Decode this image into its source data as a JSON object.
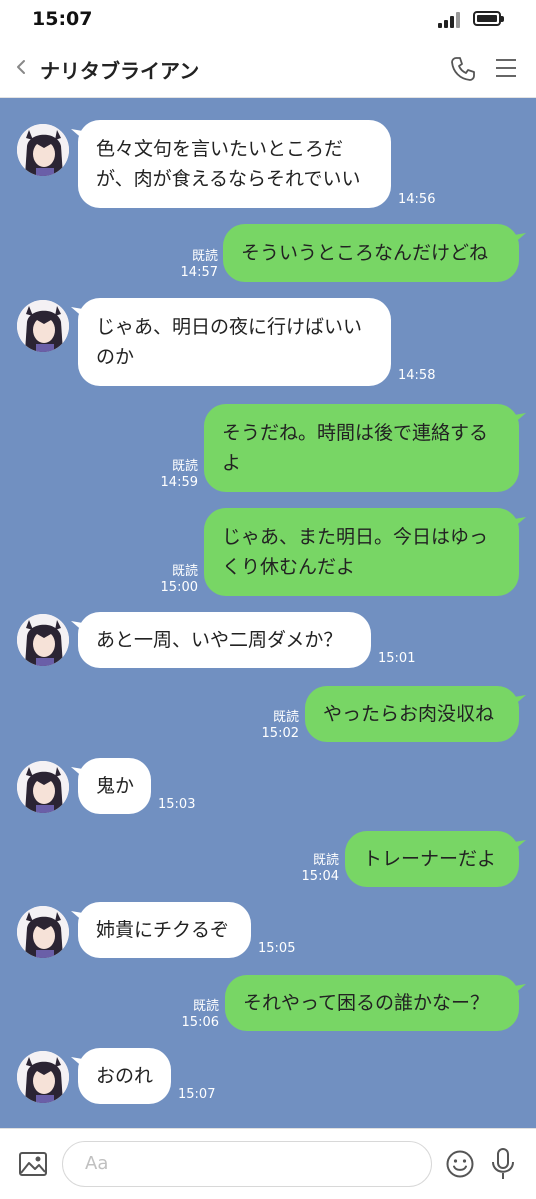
{
  "status": {
    "time": "15:07"
  },
  "header": {
    "back_icon": "chevron-left-icon",
    "title": "ナリタブライアン",
    "phone_icon": "phone-icon",
    "menu_icon": "hamburger-menu-icon"
  },
  "messages": [
    {
      "side": "in",
      "text": "色々文句を言いたいところだ\nが、肉が食えるならそれでいい",
      "time": "14:56"
    },
    {
      "side": "out",
      "text": "そういうところなんだけどね",
      "time": "14:57",
      "read": "既読"
    },
    {
      "side": "in",
      "text": "じゃあ、明日の夜に行けばいい\nのか",
      "time": "14:58"
    },
    {
      "side": "out",
      "text": "そうだね。時間は後で連絡する\nよ",
      "time": "14:59",
      "read": "既読"
    },
    {
      "side": "out",
      "text": "じゃあ、また明日。今日はゆっ\nくり休むんだよ",
      "time": "15:00",
      "read": "既読"
    },
    {
      "side": "in",
      "text": "あと一周、いや二周ダメか？",
      "time": "15:01"
    },
    {
      "side": "out",
      "text": "やったらお肉没収ね",
      "time": "15:02",
      "read": "既読"
    },
    {
      "side": "in",
      "text": "鬼か",
      "time": "15:03"
    },
    {
      "side": "out",
      "text": "トレーナーだよ",
      "time": "15:04",
      "read": "既読"
    },
    {
      "side": "in",
      "text": "姉貴にチクるぞ",
      "time": "15:05"
    },
    {
      "side": "out",
      "text": "それやって困るの誰かなー？",
      "time": "15:06",
      "read": "既読"
    },
    {
      "side": "in",
      "text": "おのれ",
      "time": "15:07"
    }
  ],
  "input": {
    "placeholder": "Aa",
    "image_icon": "image-icon",
    "emoji_icon": "smiley-icon",
    "mic_icon": "microphone-icon"
  },
  "colors": {
    "background": "#7190c1",
    "outgoing_bubble": "#78d665",
    "incoming_bubble": "#ffffff"
  }
}
